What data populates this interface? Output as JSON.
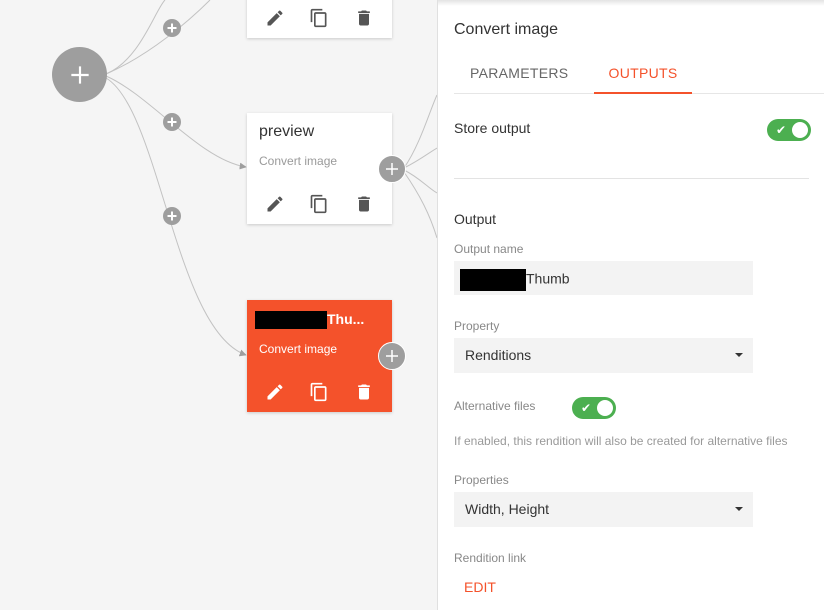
{
  "canvas": {
    "nodes": [
      {
        "id": "top",
        "title": "",
        "subtitle": ""
      },
      {
        "id": "preview",
        "title": "preview",
        "subtitle": "Convert image"
      },
      {
        "id": "thumb",
        "title_suffix": "Thu...",
        "subtitle": "Convert image"
      }
    ],
    "icons": {
      "add": "plus-icon",
      "edit": "pencil-icon",
      "copy": "copy-icon",
      "delete": "trash-icon"
    }
  },
  "panel": {
    "title": "Convert image",
    "tabs": [
      {
        "label": "PARAMETERS",
        "selected": false
      },
      {
        "label": "OUTPUTS",
        "selected": true
      }
    ],
    "store_output": {
      "label": "Store output",
      "enabled": true
    },
    "output_section": "Output",
    "output_name": {
      "label": "Output name",
      "value_suffix": "Thumb"
    },
    "property": {
      "label": "Property",
      "value": "Renditions"
    },
    "alternative_files": {
      "label": "Alternative files",
      "enabled": true,
      "helper": "If enabled, this rendition will also be created for alternative files"
    },
    "properties": {
      "label": "Properties",
      "value": "Width, Height"
    },
    "rendition_link": {
      "label": "Rendition link",
      "action": "EDIT"
    }
  },
  "colors": {
    "accent": "#f4522b",
    "toggle_on": "#4caf50",
    "neutral_button": "#9e9e9e"
  }
}
